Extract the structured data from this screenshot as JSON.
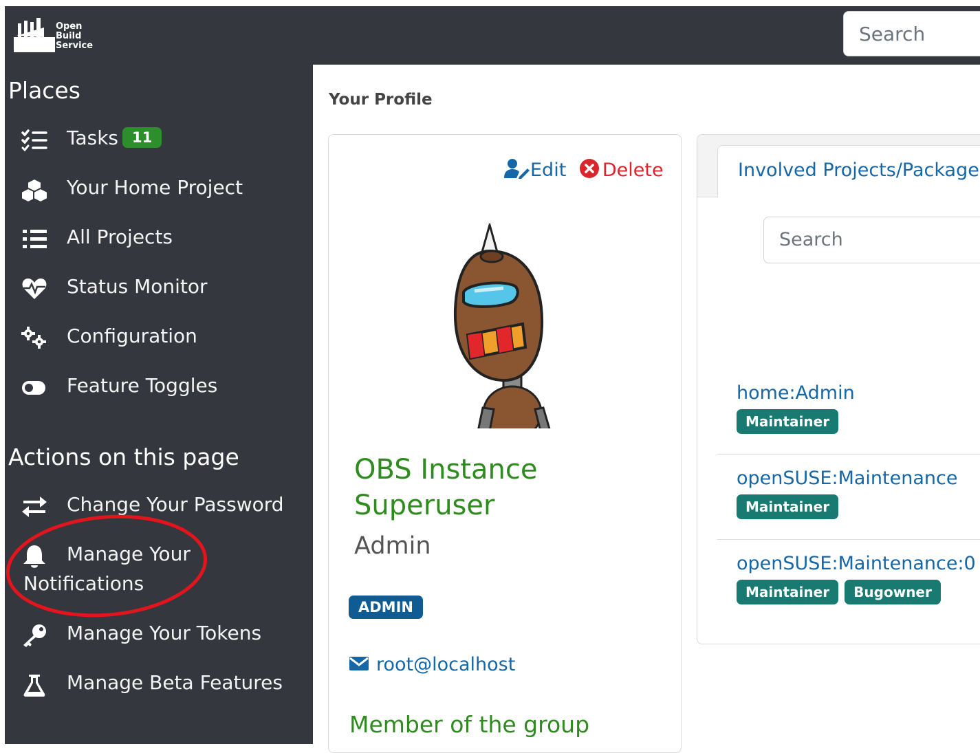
{
  "logo": {
    "lines": [
      "Open",
      "Build",
      "Service"
    ]
  },
  "topbar": {
    "search_placeholder": "Search"
  },
  "sidebar": {
    "places_title": "Places",
    "places": [
      {
        "label": "Tasks",
        "badge": "11",
        "icon": "tasks-icon"
      },
      {
        "label": "Your Home Project",
        "icon": "cubes-icon"
      },
      {
        "label": "All Projects",
        "icon": "list-icon"
      },
      {
        "label": "Status Monitor",
        "icon": "heartbeat-icon"
      },
      {
        "label": "Configuration",
        "icon": "cogs-icon"
      },
      {
        "label": "Feature Toggles",
        "icon": "toggle-icon"
      }
    ],
    "actions_title": "Actions on this page",
    "actions": [
      {
        "label": "Change Your Password",
        "icon": "exchange-icon"
      },
      {
        "label_line1": "Manage Your",
        "label_line2": "Notifications",
        "icon": "bell-icon"
      },
      {
        "label": "Manage Your Tokens",
        "icon": "key-icon"
      },
      {
        "label": "Manage Beta Features",
        "icon": "flask-icon"
      }
    ],
    "highlight_color": "#e2141d"
  },
  "main": {
    "page_title": "Your Profile",
    "profile": {
      "edit_label": "Edit",
      "delete_label": "Delete",
      "name_line1": "OBS Instance",
      "name_line2": "Superuser",
      "login": "Admin",
      "role_badge": "ADMIN",
      "email": "root@localhost",
      "groups_title": "Member of the group"
    },
    "involved": {
      "tab_label": "Involved Projects/Packages",
      "search_placeholder": "Search",
      "projects": [
        {
          "name": "home:Admin",
          "roles": [
            "Maintainer"
          ]
        },
        {
          "name": "openSUSE:Maintenance",
          "roles": [
            "Maintainer"
          ]
        },
        {
          "name": "openSUSE:Maintenance:0",
          "roles": [
            "Maintainer",
            "Bugowner"
          ]
        }
      ]
    }
  },
  "colors": {
    "sidebar_bg": "#34373d",
    "green_badge": "#2c8f2c",
    "role_tag": "#187a71",
    "link": "#1567a8",
    "heading_green": "#2e8b1e",
    "delete_red": "#d9252b"
  }
}
